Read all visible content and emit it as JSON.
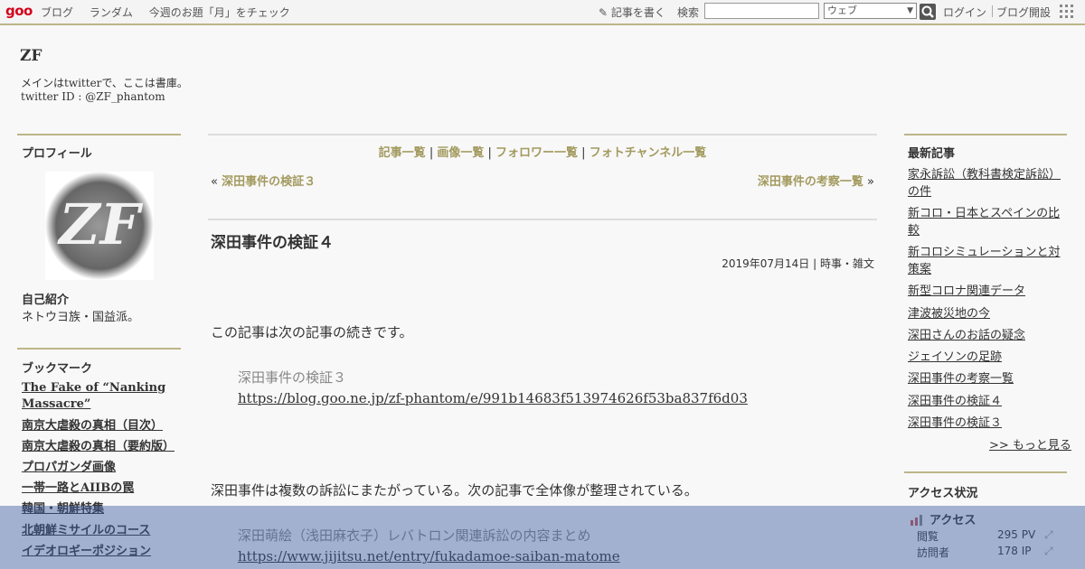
{
  "topbar": {
    "logo": "goo",
    "nav": [
      "ブログ",
      "ランダム",
      "今週のお題「月」をチェック"
    ],
    "write": "記事を書く",
    "search_label": "検索",
    "search_value": "",
    "search_scope": "ウェブ",
    "login": "ログイン",
    "blog_start": "ブログ開設"
  },
  "site": {
    "title": "ZF",
    "desc1": "メインはtwitterで、ここは書庫。",
    "desc2": "twitter ID : @ZF_phantom"
  },
  "left": {
    "profile_title": "プロフィール",
    "intro_heading": "自己紹介",
    "intro_text": "ネトウヨ族・国益派。",
    "bookmark_title": "ブックマーク",
    "bookmarks": [
      "The Fake of “Nanking Massacre”",
      "南京大虐殺の真相（目次）",
      "南京大虐殺の真相（要約版）",
      "プロパガンダ画像",
      "一帯一路とAIIBの罠",
      "韓国・朝鮮特集",
      "北朝鮮ミサイルのコース",
      "イデオロギーポジション"
    ]
  },
  "main": {
    "nav": [
      "記事一覧",
      "画像一覧",
      "フォロワー一覧",
      "フォトチャンネル一覧"
    ],
    "prev": "深田事件の検証３",
    "next": "深田事件の考察一覧",
    "title": "深田事件の検証４",
    "date": "2019年07月14日",
    "category": "時事・雑文",
    "p1": "この記事は次の記事の続きです。",
    "q1_title": "深田事件の検証３",
    "q1_link": "https://blog.goo.ne.jp/zf-phantom/e/991b14683f513974626f53ba837f6d03",
    "p2": "深田事件は複数の訴訟にまたがっている。次の記事で全体像が整理されている。",
    "q2_title": "深田萌絵（浅田麻衣子）レバトロン関連訴訟の内容まとめ",
    "q2_link": "https://www.jijitsu.net/entry/fukadamoe-saiban-matome"
  },
  "right": {
    "recent_title": "最新記事",
    "recent": [
      "家永訴訟（教科書検定訴訟）の件",
      "新コロ・日本とスペインの比較",
      "新コロシミュレーションと対策案",
      "新型コロナ関連データ",
      "津波被災地の今",
      "深田さんのお話の疑念",
      "ジェイソンの足跡",
      "深田事件の考察一覧",
      "深田事件の検証４",
      "深田事件の検証３"
    ],
    "more": ">> もっと見る",
    "access_title": "アクセス状況",
    "access_heading": "アクセス",
    "views_label": "閲覧",
    "views_value": "295 PV",
    "visitors_label": "訪問者",
    "visitors_value": "178 IP"
  }
}
